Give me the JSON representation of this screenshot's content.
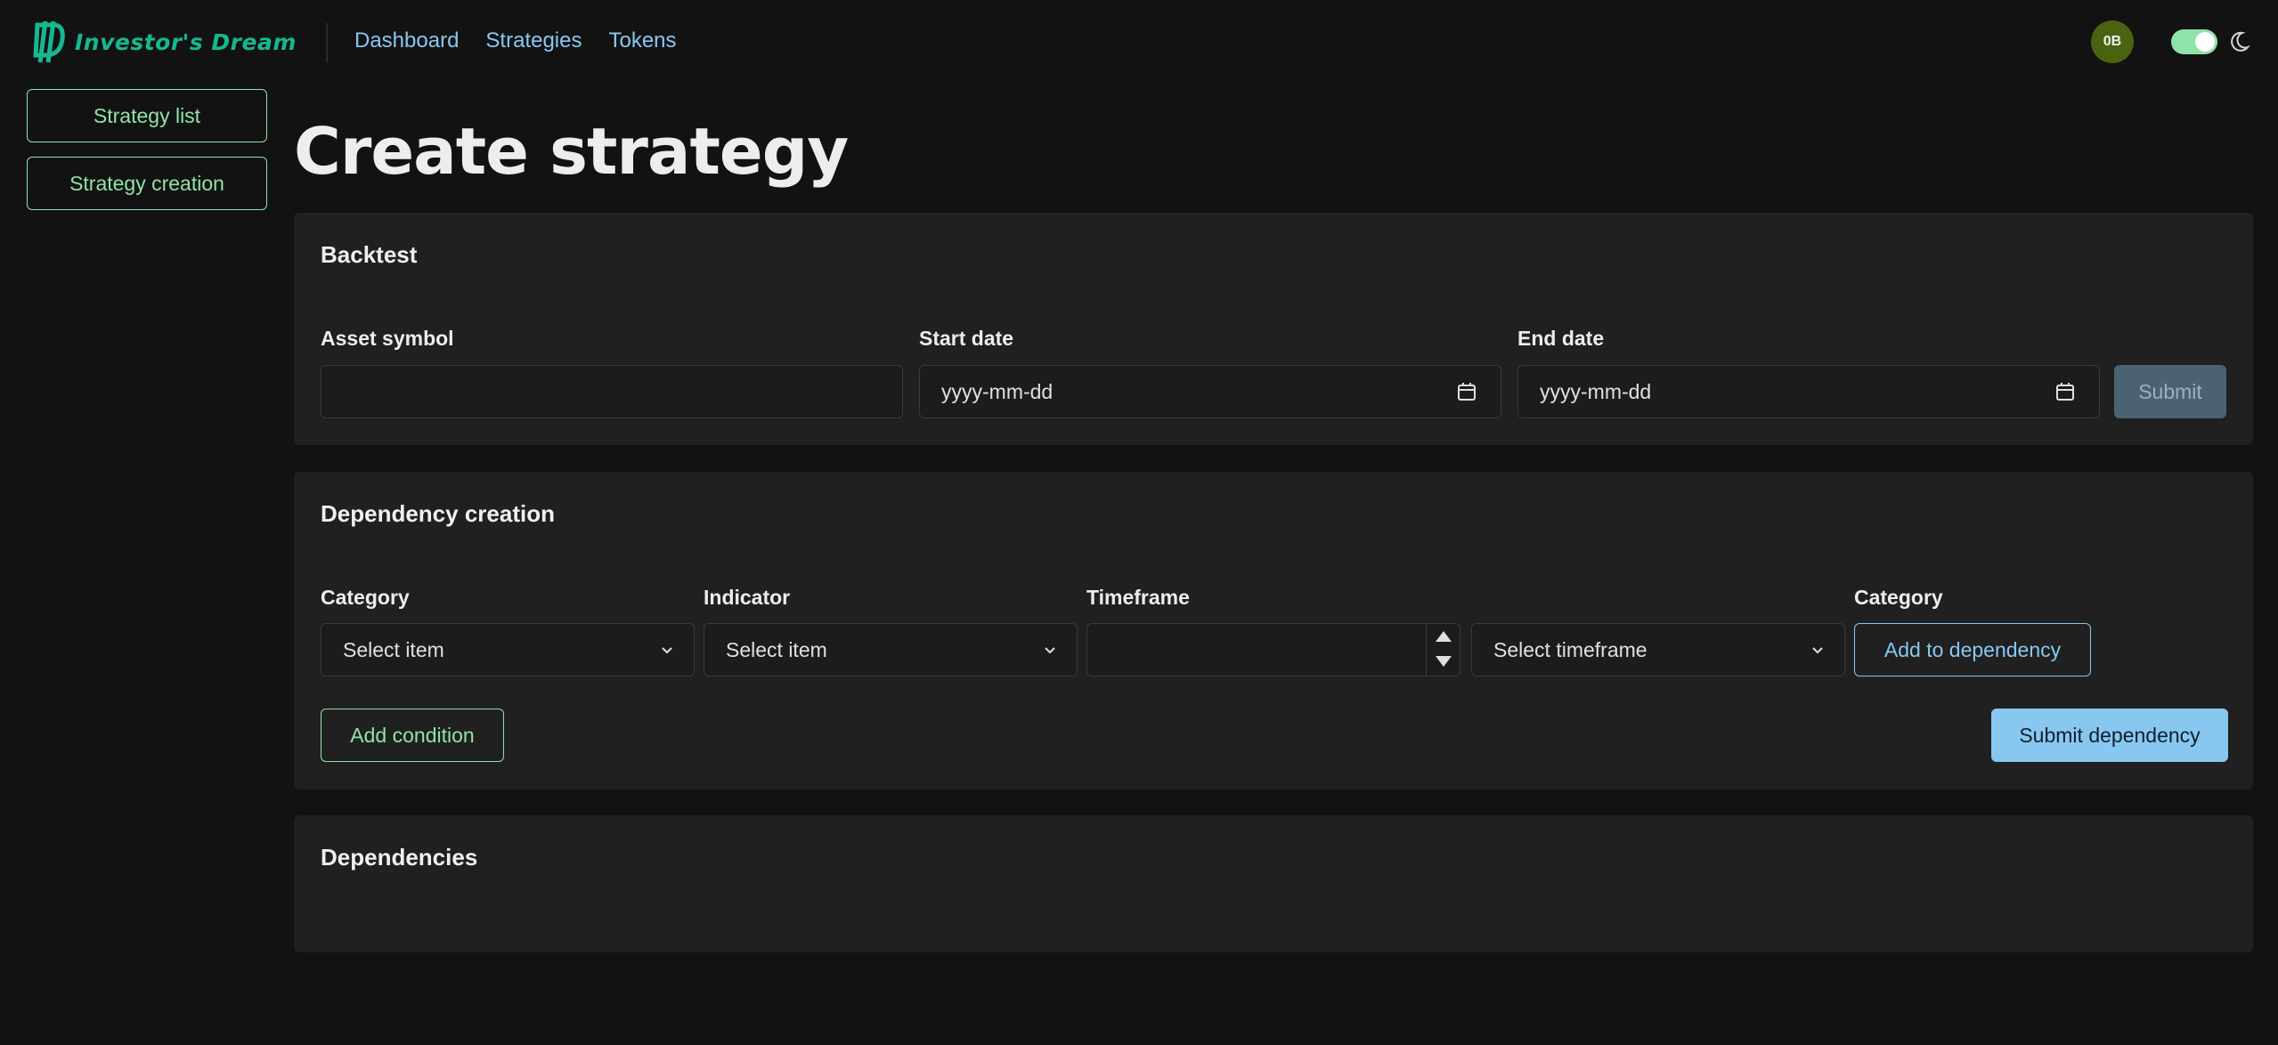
{
  "app": {
    "brand": "Investor's Dream",
    "brand_color": "#16b88f",
    "nav": [
      "Dashboard",
      "Strategies",
      "Tokens"
    ],
    "avatar_initials": "0B",
    "theme_toggle": "on"
  },
  "sidebar": {
    "items": [
      {
        "label": "Strategy list"
      },
      {
        "label": "Strategy creation"
      }
    ]
  },
  "page": {
    "title": "Create strategy"
  },
  "backtest": {
    "title": "Backtest",
    "asset_label": "Asset symbol",
    "asset_value": "",
    "start_label": "Start date",
    "start_placeholder": "yyyy-mm-dd",
    "end_label": "End date",
    "end_placeholder": "yyyy-mm-dd",
    "submit_label": "Submit"
  },
  "dependency_creation": {
    "title": "Dependency creation",
    "category_label": "Category",
    "category_value": "Select item",
    "indicator_label": "Indicator",
    "indicator_value": "Select item",
    "timeframe_label": "Timeframe",
    "timeframe_value": "",
    "timeframe_select_value": "Select timeframe",
    "category2_label": "Category",
    "add_to_dependency_label": "Add to dependency",
    "add_condition_label": "Add condition",
    "submit_dependency_label": "Submit dependency"
  },
  "dependencies": {
    "title": "Dependencies"
  }
}
